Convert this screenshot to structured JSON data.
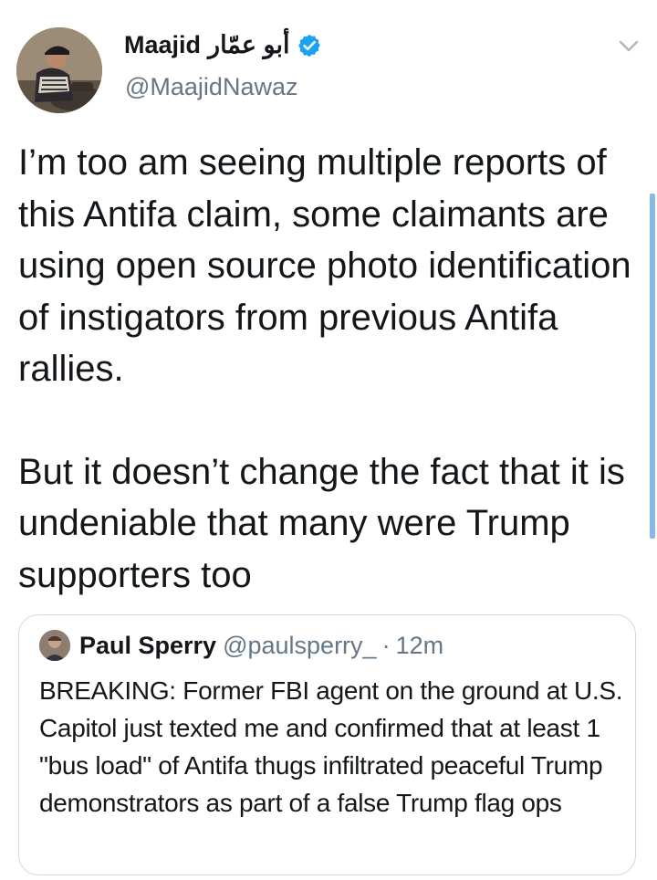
{
  "author": {
    "name": "Maajid",
    "name_arabic": "أبو عمّار",
    "handle": "@MaajidNawaz",
    "verified": true
  },
  "tweet": {
    "paragraph1": "I’m too am seeing multiple reports of this Antifa claim, some claimants are using open source photo identification of instigators from previous Antifa rallies.",
    "paragraph2": "But it doesn’t change the fact that it is undeniable that many were Trump supporters too"
  },
  "quoted_tweet": {
    "name": "Paul Sperry",
    "handle": "@paulsperry_",
    "separator": "·",
    "time": "12m",
    "text": "BREAKING: Former FBI agent on the ground at U.S. Capitol just texted me and confirmed that at least 1 \"bus load\" of Antifa thugs infiltrated peaceful Trump demonstrators as part of a false Trump flag ops"
  },
  "icons": {
    "verified": "verified-badge-icon",
    "menu": "chevron-down-icon"
  },
  "colors": {
    "text": "#14171a",
    "secondary": "#657786",
    "verified": "#1da1f2",
    "border": "#cfd9de",
    "scrollbar": "#88b8e4"
  }
}
